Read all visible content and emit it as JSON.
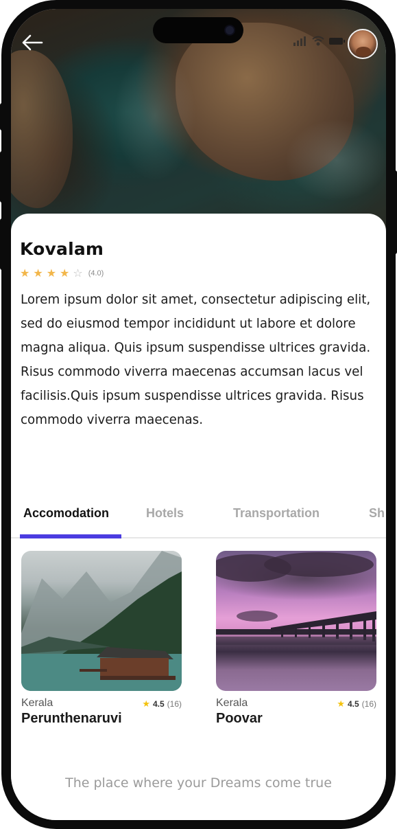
{
  "header": {
    "back_icon": "arrow-left-icon",
    "avatar_icon": "user-avatar",
    "status_icons": [
      "signal-icon",
      "wifi-icon",
      "battery-icon"
    ]
  },
  "place": {
    "title": "Kovalam",
    "rating": 4,
    "rating_max": 5,
    "rating_label": "(4.0)",
    "description": [
      "Lorem ipsum dolor sit amet, consectetur adipiscing elit, sed do eiusmod tempor incididunt ut labore et dolore magna aliqua. Quis ipsum suspendisse ultrices gravida.",
      "Risus commodo viverra maecenas accumsan lacus vel facilisis.Quis ipsum suspendisse ultrices gravida. Risus commodo viverra maecenas."
    ]
  },
  "tabs": [
    {
      "label": "Accomodation",
      "active": true
    },
    {
      "label": "Hotels",
      "active": false
    },
    {
      "label": "Transportation",
      "active": false
    },
    {
      "label": "Sh",
      "active": false
    }
  ],
  "cards": [
    {
      "location": "Kerala",
      "rating": "4.5",
      "count": "(16)",
      "name": "Perunthenaruvi"
    },
    {
      "location": "Kerala",
      "rating": "4.5",
      "count": "(16)",
      "name": "Poovar"
    }
  ],
  "footer": {
    "tagline": "The place where your Dreams come true"
  },
  "colors": {
    "accent": "#4b3ce0",
    "star": "#f2b64a",
    "card_star": "#f4c20d"
  }
}
